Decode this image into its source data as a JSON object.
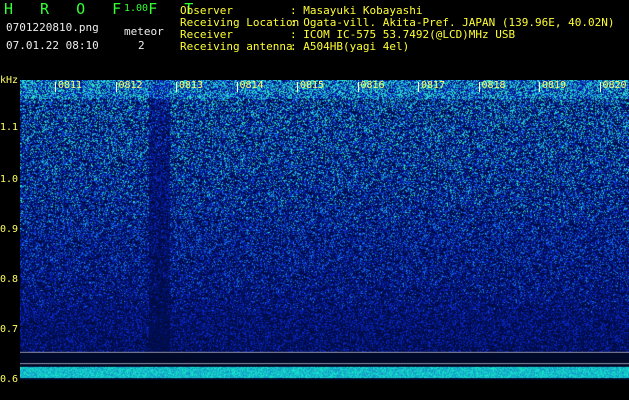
{
  "header": {
    "app_title": "H R O F F T",
    "version": "1.00",
    "filename": "0701220810.png",
    "datetime": "07.01.22 08:10",
    "meteor_label": "meteor",
    "meteor_count": "2"
  },
  "info": {
    "observer_label": "Observer",
    "observer_value": ": Masayuki Kobayashi",
    "location_label": "Receiving Location",
    "location_value": ": Ogata-vill. Akita-Pref. JAPAN (139.96E, 40.02N)",
    "receiver_label": "Receiver",
    "receiver_value": ": ICOM IC-575 53.7492(@LCD)MHz USB",
    "antenna_label": "Receiving antenna",
    "antenna_value": ": A504HB(yagi 4el)"
  },
  "axis": {
    "unit": "kHz",
    "y_ticks": [
      "1.1",
      "1.0",
      "0.9",
      "0.8",
      "0.7",
      "0.6"
    ],
    "x_ticks": [
      "0811",
      "0812",
      "0813",
      "0814",
      "0815",
      "0816",
      "0817",
      "0818",
      "0819",
      "0820"
    ]
  },
  "colors": {
    "background": "#000000",
    "header_text": "#ffff33",
    "title_text": "#33ff33",
    "spectrogram_low": "#001040",
    "spectrogram_high": "#33ffcc"
  }
}
